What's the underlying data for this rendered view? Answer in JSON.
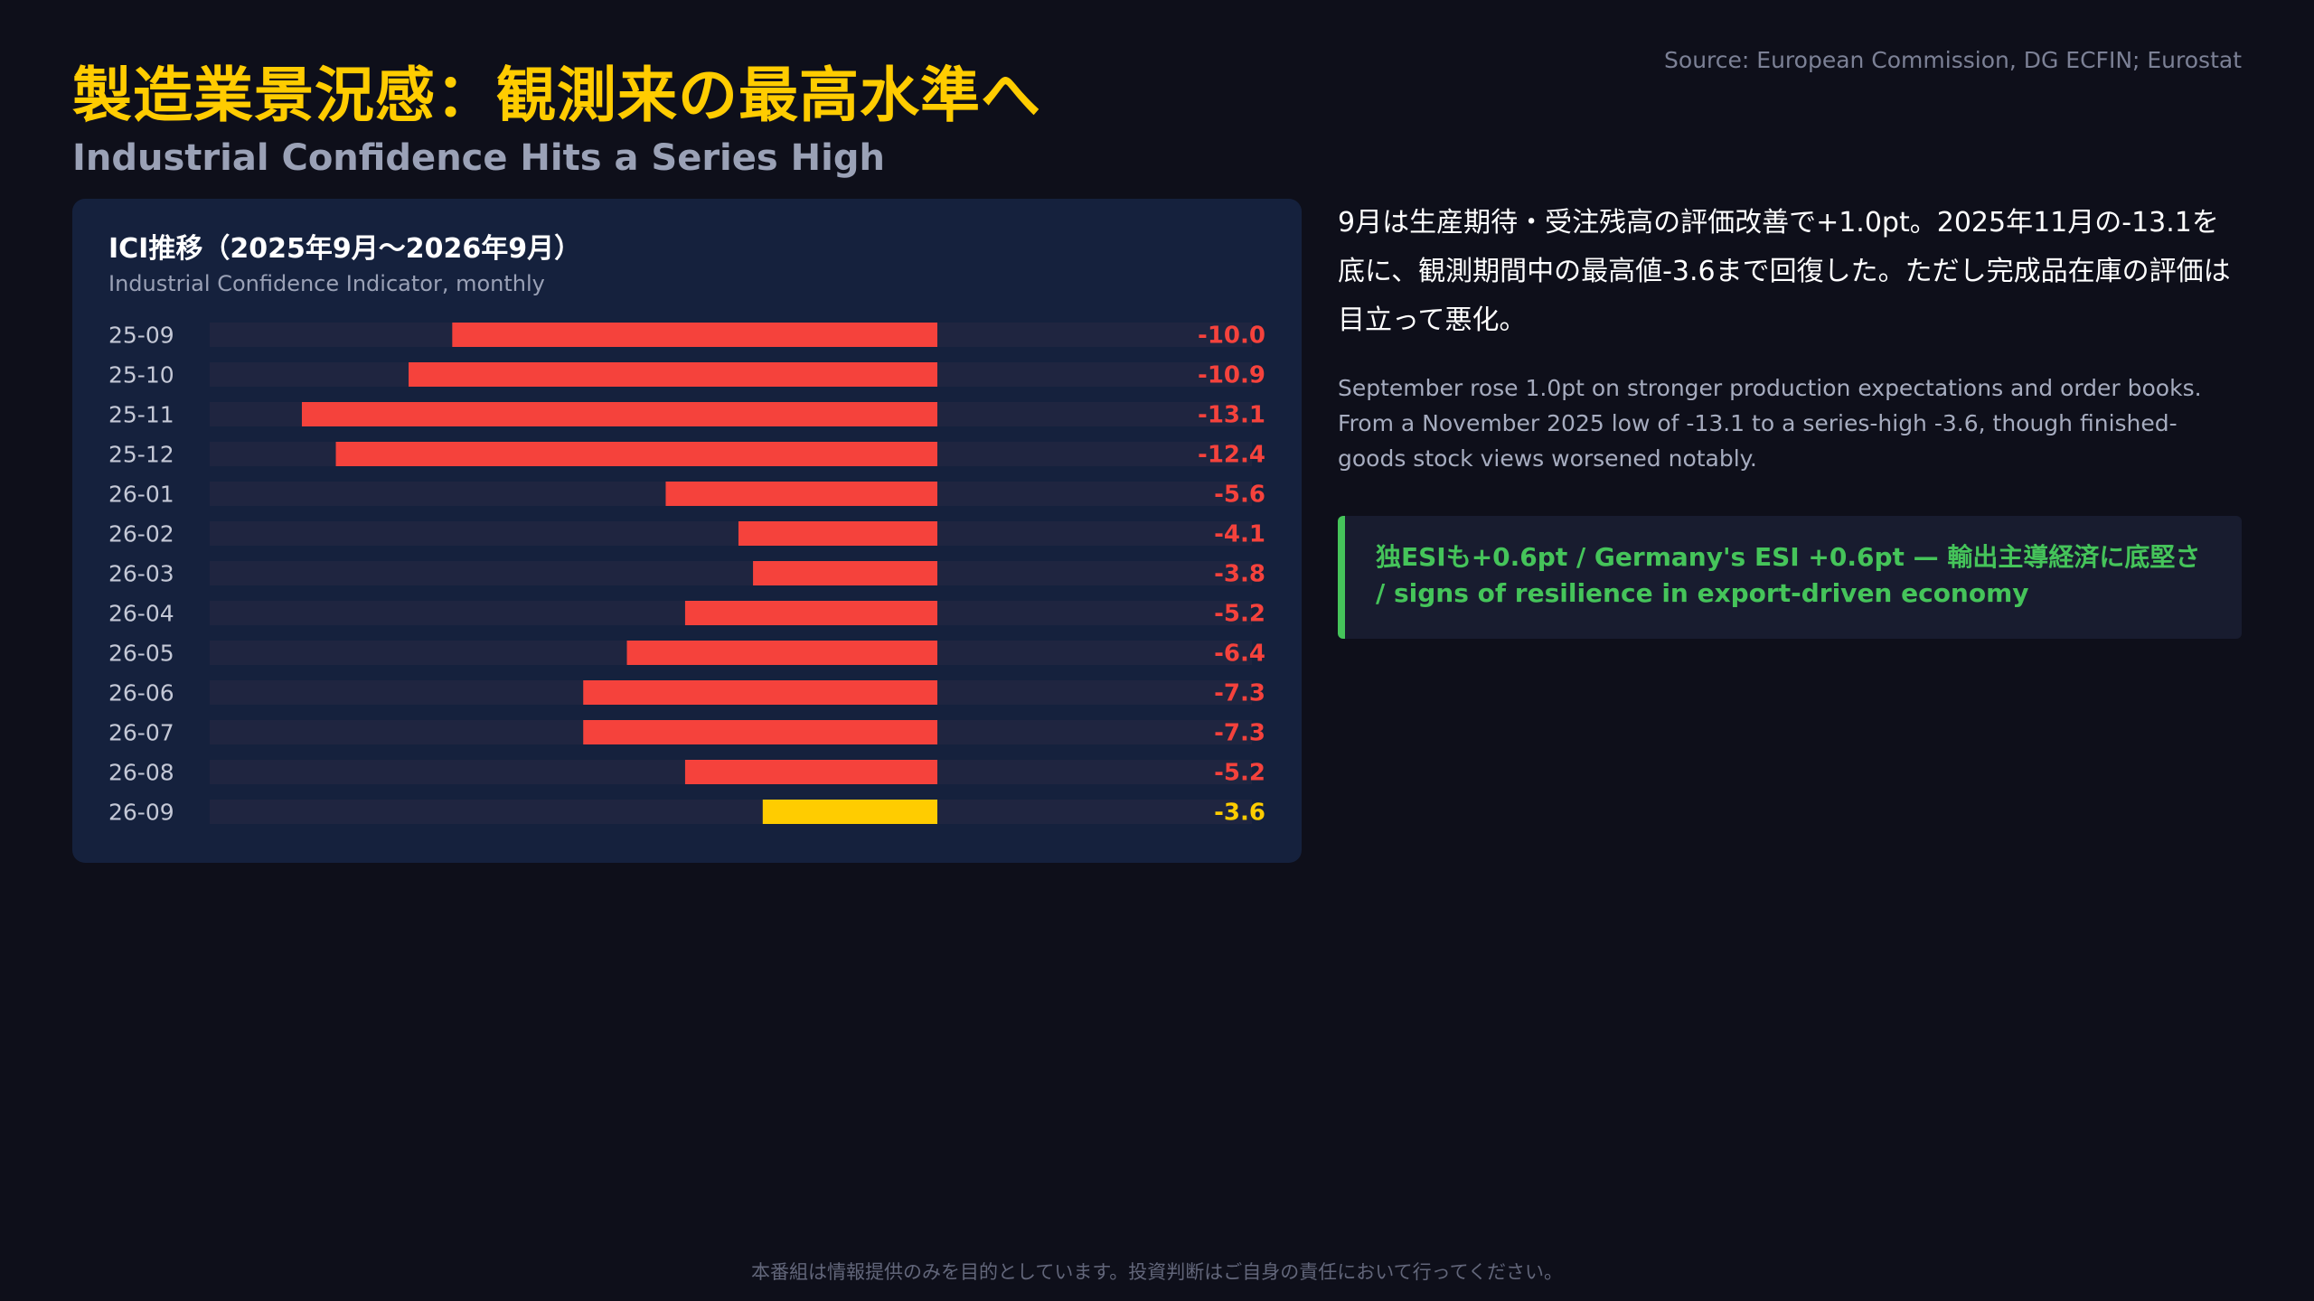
{
  "header": {
    "title": "製造業景況感：観測来の最高水準へ",
    "subtitle": "Industrial Confidence Hits a Series High",
    "source": "Source: European Commission, DG ECFIN; Eurostat"
  },
  "panel": {
    "title": "ICI推移（2025年9月〜2026年9月）",
    "subtitle": "Industrial Confidence Indicator, monthly"
  },
  "commentary": {
    "jp": "9月は生産期待・受注残高の評価改善で+1.0pt。2025年11月の-13.1を底に、観測期間中の最高値-3.6まで回復した。ただし完成品在庫の評価は目立って悪化。",
    "en": "September rose 1.0pt on stronger production expectations and order books. From a November 2025 low of -13.1 to a series-high -3.6, though finished-goods stock views worsened notably.",
    "callout": "独ESIも+0.6pt / Germany's ESI +0.6pt — 輸出主導経済に底堅さ / signs of resilience in export-driven economy"
  },
  "footer": {
    "disclaimer": "本番組は情報提供のみを目的としています。投資判断はご自身の責任において行ってください。"
  },
  "colors": {
    "negative": "#f5423c",
    "highlight": "#ffcc00",
    "track": "#1f2540",
    "callout_accent": "#45c45a"
  },
  "chart_data": {
    "type": "bar",
    "orientation": "horizontal",
    "categories": [
      "25-09",
      "25-10",
      "25-11",
      "25-12",
      "26-01",
      "26-02",
      "26-03",
      "26-04",
      "26-05",
      "26-06",
      "26-07",
      "26-08",
      "26-09"
    ],
    "values": [
      -10.0,
      -10.9,
      -13.1,
      -12.4,
      -5.6,
      -4.1,
      -3.8,
      -5.2,
      -6.4,
      -7.3,
      -7.3,
      -5.2,
      -3.6
    ],
    "value_labels": [
      "-10.0",
      "-10.9",
      "-13.1",
      "-12.4",
      "-5.6",
      "-4.1",
      "-3.8",
      "-5.2",
      "-6.4",
      "-7.3",
      "-7.3",
      "-5.2",
      "-3.6"
    ],
    "highlight_index": 12,
    "xlim": [
      -15,
      5
    ],
    "title": "ICI推移（2025年9月〜2026年9月）",
    "subtitle": "Industrial Confidence Indicator, monthly",
    "grid": false,
    "legend": "none"
  }
}
